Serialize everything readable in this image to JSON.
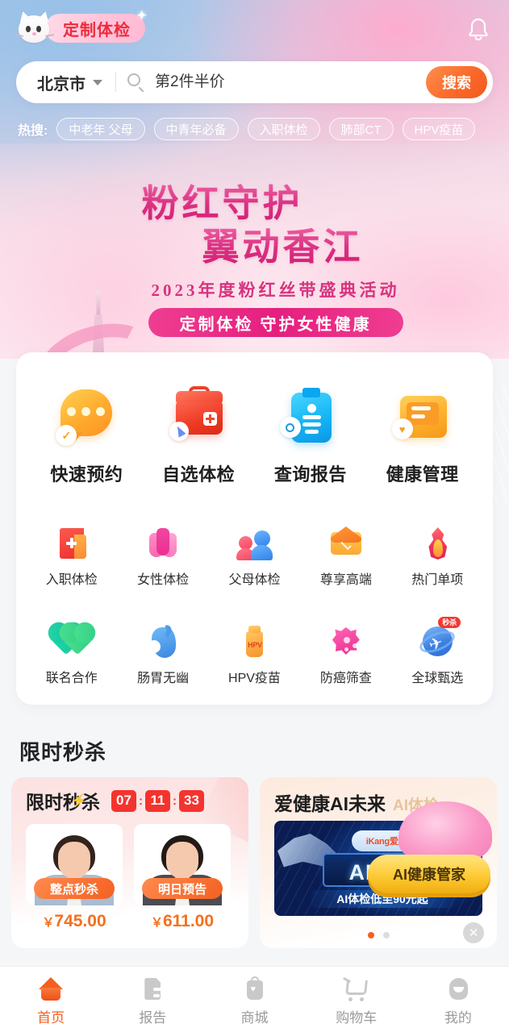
{
  "header": {
    "logo_text": "定制体检",
    "logo_icon": "cat-mascot-icon",
    "bell_icon": "bell-icon"
  },
  "search": {
    "city": "北京市",
    "caret_icon": "chevron-down-icon",
    "search_icon": "search-icon",
    "placeholder": "第2件半价",
    "value": "",
    "button_label": "搜索"
  },
  "hot_search": {
    "label": "热搜:",
    "tags": [
      "中老年 父母",
      "中青年必备",
      "入职体检",
      "肺部CT",
      "HPV疫苗"
    ]
  },
  "banner": {
    "line1": "粉红守护",
    "line2": "翼动香江",
    "subtitle": "2023年度粉红丝带盛典活动",
    "pill": "定制体检 守护女性健康"
  },
  "quick_entries": [
    {
      "label": "快速预约",
      "icon": "chat-bubble-check-icon"
    },
    {
      "label": "自选体检",
      "icon": "medical-kit-icon"
    },
    {
      "label": "查询报告",
      "icon": "report-search-icon"
    },
    {
      "label": "健康管理",
      "icon": "folder-heart-icon"
    }
  ],
  "category_row1": [
    {
      "label": "入职体检",
      "icon": "hospital-cross-icon"
    },
    {
      "label": "女性体检",
      "icon": "tulip-flower-icon"
    },
    {
      "label": "父母体检",
      "icon": "two-people-icon"
    },
    {
      "label": "尊享高端",
      "icon": "envelope-premium-icon"
    },
    {
      "label": "热门单项",
      "icon": "flame-icon"
    }
  ],
  "category_row2": [
    {
      "label": "联名合作",
      "icon": "double-heart-icon",
      "badge": ""
    },
    {
      "label": "肠胃无幽",
      "icon": "stomach-icon",
      "badge": ""
    },
    {
      "label": "HPV疫苗",
      "icon": "vaccine-vial-icon",
      "badge": "",
      "vial_text": "HPV"
    },
    {
      "label": "防癌筛查",
      "icon": "cancer-cell-icon",
      "badge": ""
    },
    {
      "label": "全球甄选",
      "icon": "globe-plane-icon",
      "badge": "秒杀"
    }
  ],
  "sections": {
    "flash_sale_title": "限时秒杀"
  },
  "flash_sale": {
    "card_title": "限时秒杀",
    "bolt_icon": "lightning-bolt-icon",
    "countdown": {
      "hours": "07",
      "minutes": "11",
      "seconds": "33",
      "separator": ":"
    },
    "products": [
      {
        "badge": "整点秒杀",
        "price": "745.00",
        "currency": "￥",
        "image": "woman-portrait-photo"
      },
      {
        "badge": "明日预告",
        "price": "611.00",
        "currency": "￥",
        "image": "man-portrait-photo"
      }
    ]
  },
  "ai_card": {
    "title": "爱健康AI未来",
    "subtitle": "AI体检",
    "banner_brand": "iKang爱康",
    "banner_headline": "AI未来",
    "banner_footer": "AI体检低至90元起",
    "cta_label": "AI健康管家",
    "carousel": {
      "total": 2,
      "active": 1
    },
    "close_icon": "close-icon"
  },
  "tabbar": [
    {
      "label": "首页",
      "icon": "home-icon",
      "active": true
    },
    {
      "label": "报告",
      "icon": "report-icon",
      "active": false
    },
    {
      "label": "商城",
      "icon": "shop-bag-icon",
      "active": false
    },
    {
      "label": "购物车",
      "icon": "cart-icon",
      "active": false
    },
    {
      "label": "我的",
      "icon": "user-avatar-icon",
      "active": false
    }
  ],
  "colors": {
    "accent_orange": "#f4601f",
    "flash_red": "#f5332e",
    "pink_brand": "#e51f7e",
    "logo_red": "#ee2b3c",
    "page_bg": "#f5f6f8"
  }
}
